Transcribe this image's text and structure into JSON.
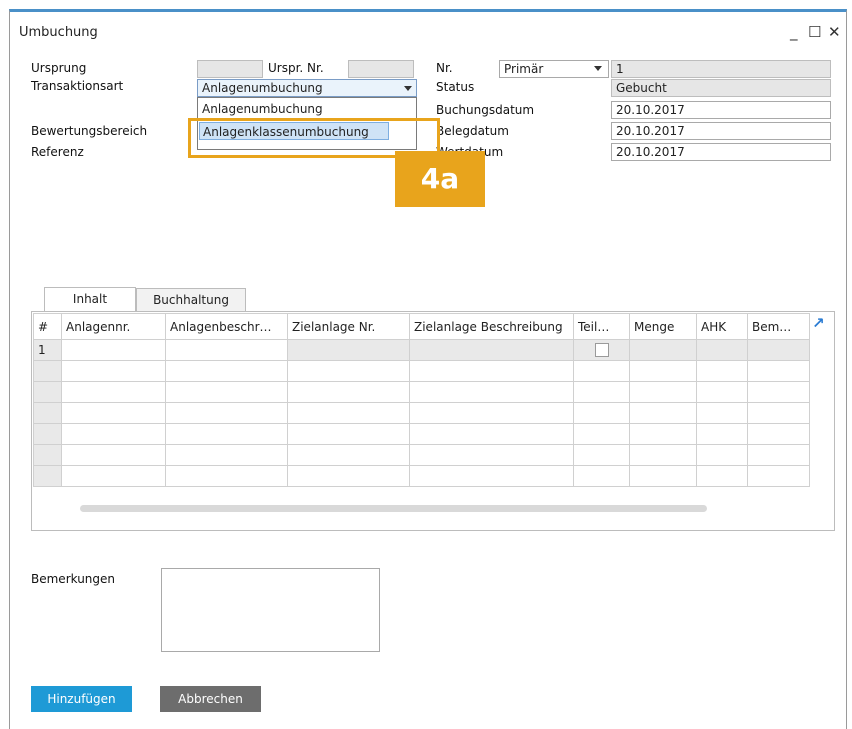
{
  "window": {
    "title": "Umbuchung",
    "minimize": "_",
    "maximize": "☐",
    "close": "✕"
  },
  "header": {
    "ursprung_label": "Ursprung",
    "ursprung_value": "",
    "urspr_nr_label": "Urspr. Nr.",
    "urspr_nr_value": "",
    "transaktionsart_label": "Transaktionsart",
    "transaktionsart_value": "Anlagenumbuchung",
    "transaktionsart_options": [
      "Anlagenumbuchung",
      "Anlagenklassenumbuchung"
    ],
    "selected_option_index": 1,
    "bewertungsbereich_label": "Bewertungsbereich",
    "referenz_label": "Referenz",
    "nr_label": "Nr.",
    "nr_series": "Primär",
    "nr_value": "1",
    "status_label": "Status",
    "status_value": "Gebucht",
    "buchungsdatum_label": "Buchungsdatum",
    "buchungsdatum_value": "20.10.2017",
    "belegdatum_label": "Belegdatum",
    "belegdatum_value": "20.10.2017",
    "wertdatum_label": "Wertdatum",
    "wertdatum_value": "20.10.2017"
  },
  "callout": {
    "badge": "4a",
    "color": "#e8a41c"
  },
  "tabs": [
    {
      "label": "Inhalt",
      "active": true
    },
    {
      "label": "Buchhaltung",
      "active": false
    }
  ],
  "grid": {
    "columns": [
      "#",
      "Anlagennr.",
      "Anlagenbeschr…",
      "Zielanlage Nr.",
      "Zielanlage Beschreibung",
      "Teil…",
      "Menge",
      "AHK",
      "Bem…"
    ],
    "rows": [
      [
        "1",
        "",
        "",
        "",
        "",
        "",
        "",
        "",
        ""
      ],
      [
        "",
        "",
        "",
        "",
        "",
        "",
        "",
        "",
        ""
      ],
      [
        "",
        "",
        "",
        "",
        "",
        "",
        "",
        "",
        ""
      ],
      [
        "",
        "",
        "",
        "",
        "",
        "",
        "",
        "",
        ""
      ],
      [
        "",
        "",
        "",
        "",
        "",
        "",
        "",
        "",
        ""
      ],
      [
        "",
        "",
        "",
        "",
        "",
        "",
        "",
        "",
        ""
      ],
      [
        "",
        "",
        "",
        "",
        "",
        "",
        "",
        "",
        ""
      ]
    ],
    "expand_icon": "↗"
  },
  "footer": {
    "bemerkungen_label": "Bemerkungen",
    "bemerkungen_value": "",
    "add_button": "Hinzufügen",
    "cancel_button": "Abbrechen",
    "add_color": "#1e9ad6",
    "cancel_color": "#6d6d6d"
  }
}
